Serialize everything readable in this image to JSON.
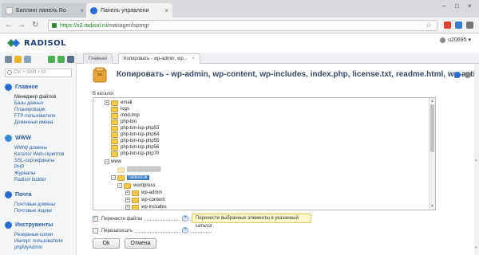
{
  "browser": {
    "tabs": [
      {
        "title": "Биллинг панель Ro",
        "close": "×"
      },
      {
        "title": "Панель управлени",
        "close": "×"
      }
    ],
    "url_prefix": "https://",
    "url_host": "s3.radisol.ru",
    "url_path": "/manager/ispmgr",
    "back": "←",
    "forward": "→",
    "reload": "↻",
    "star": "☆",
    "win_min": "–",
    "win_max": "□",
    "win_close": "×"
  },
  "header": {
    "brand": "RADISOL",
    "user": "u20695",
    "user_caret": "▾"
  },
  "sidebar": {
    "search_placeholder": "Ctrl + Shift + M",
    "sections": [
      {
        "title": "Главное",
        "icon": "home-icon",
        "items": [
          "Менеджер файлов",
          "Базы данных",
          "Планировщик",
          "FTP-пользователи",
          "Доменные имена"
        ]
      },
      {
        "title": "WWW",
        "icon": "globe-icon",
        "items": [
          "WWW-домены",
          "Каталог Web-скриптов",
          "SSL-сертификаты",
          "PHP",
          "Журналы",
          "Radisol builder"
        ]
      },
      {
        "title": "Почта",
        "icon": "mail-icon",
        "items": [
          "Почтовые домены",
          "Почтовые ящики"
        ]
      },
      {
        "title": "Инструменты",
        "icon": "tools-icon",
        "items": [
          "Резервные копии",
          "Импорт пользователя",
          "phpMyAdmin"
        ]
      }
    ]
  },
  "main_tabs": [
    {
      "label": "Главная"
    },
    {
      "label": "Копировать - wp-admin, wp...",
      "close": "×"
    }
  ],
  "dialog": {
    "title": "Копировать - wp-admin, wp-content, wp-includes, index.php, license.txt, readme.html, wp-activate...",
    "catalog_label": "В каталог",
    "tree": [
      {
        "label": "email",
        "pm": "+",
        "depth": 1
      },
      {
        "label": "logs",
        "pm": "",
        "depth": 1
      },
      {
        "label": "mod-tmp",
        "pm": "",
        "depth": 1
      },
      {
        "label": "php-bin",
        "pm": "",
        "depth": 1
      },
      {
        "label": "php-bin-isp-php53",
        "pm": "",
        "depth": 1
      },
      {
        "label": "php-bin-isp-php54",
        "pm": "",
        "depth": 1
      },
      {
        "label": "php-bin-isp-php55",
        "pm": "",
        "depth": 1
      },
      {
        "label": "php-bin-isp-php56",
        "pm": "",
        "depth": 1
      },
      {
        "label": "php-bin-isp-php70",
        "pm": "",
        "depth": 1
      },
      {
        "label": "www",
        "pm": "−",
        "depth": 1
      },
      {
        "label": "██████████",
        "pm": "",
        "depth": 2,
        "blur": true
      },
      {
        "label": "radisol.lk",
        "pm": "−",
        "depth": 2,
        "selected": true
      },
      {
        "label": "wordpress",
        "pm": "−",
        "depth": 3
      },
      {
        "label": "wp-admin",
        "pm": "+",
        "depth": 4
      },
      {
        "label": "wp-content",
        "pm": "+",
        "depth": 4
      },
      {
        "label": "wp-includes",
        "pm": "+",
        "depth": 4
      }
    ],
    "opt_move": "Перенести файлы",
    "opt_move_checked": "✓",
    "opt_overwrite": "Перезаписать",
    "help": "?",
    "tooltip": "Перенести выбранные элементы в указанный каталог",
    "ok": "Ok",
    "cancel": "Отмена"
  },
  "colors": {
    "accent": "#2a5aa8",
    "selection": "#3c78c8",
    "folder": "#f2c94c"
  }
}
